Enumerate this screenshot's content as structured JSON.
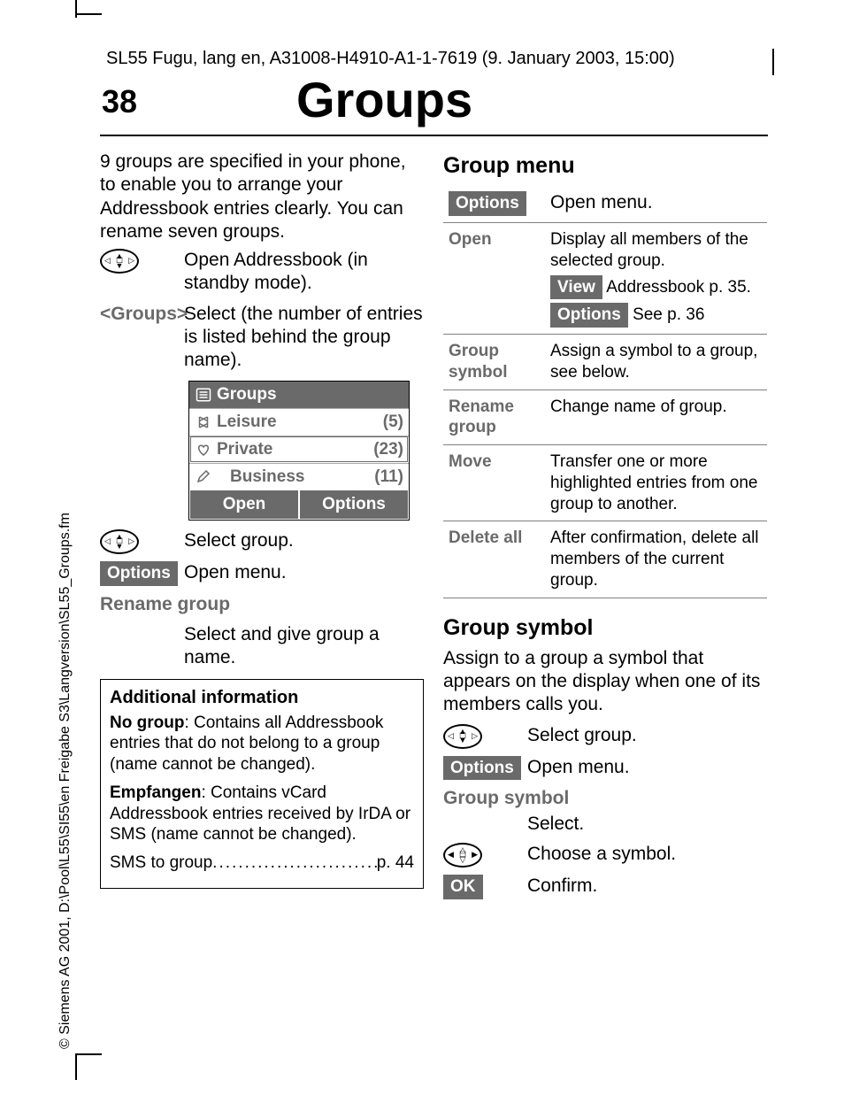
{
  "header_line": "SL55 Fugu, lang en, A31008-H4910-A1-1-7619 (9. January 2003, 15:00)",
  "side_copyright": "© Siemens AG 2001, D:\\Pool\\L55\\SI55\\en Freigabe S3\\Langversion\\SL55_Groups.fm",
  "page_number": "38",
  "title": "Groups",
  "left": {
    "intro": "9 groups are specified in your phone, to enable you to arrange your Addressbook entries clearly. You can rename seven groups.",
    "open_addr": "Open Addressbook (in standby mode).",
    "groups_tag": "<Groups>",
    "select_num": "Select (the number of entries is listed behind the group name).",
    "screen_title": "Groups",
    "screen_rows": [
      {
        "name": "Leisure",
        "count": "(5)"
      },
      {
        "name": "Private",
        "count": "(23)"
      },
      {
        "name": "Business",
        "count": "(11)"
      }
    ],
    "screen_softkeys": [
      "Open",
      "Options"
    ],
    "select_group": "Select group.",
    "options": "Options",
    "open_menu": "Open menu.",
    "rename_group": "Rename group",
    "rename_group_body": "Select and give group a name.",
    "info_title": "Additional information",
    "info_nogroup_lead": "No group",
    "info_nogroup_body": ": Contains all Addressbook entries that do not belong to a group (name cannot be changed).",
    "info_empf_lead": "Empfangen",
    "info_empf_body": ": Contains vCard Addressbook entries received by IrDA or SMS (name cannot be changed).",
    "info_sms_label": "SMS to group",
    "info_sms_page": "p. 44"
  },
  "right": {
    "group_menu_title": "Group menu",
    "options": "Options",
    "open_menu": "Open menu.",
    "rows": {
      "open_label": "Open",
      "open_body1": "Display all members of the selected group.",
      "open_view": "View",
      "open_view_body": "Addressbook p. 35.",
      "open_options": "Options",
      "open_options_body": "See p. 36",
      "groupsym_label": "Group symbol",
      "groupsym_body": "Assign a symbol to a group, see below.",
      "rename_label": "Rename group",
      "rename_body": "Change name of group.",
      "move_label": "Move",
      "move_body": "Transfer one or more highlighted entries from one group to another.",
      "delete_label": "Delete all",
      "delete_body": "After confirmation, delete all members of the current group."
    },
    "group_symbol_title": "Group symbol",
    "group_symbol_intro": "Assign to a group a symbol that appears on the display when one of its members calls you.",
    "select_group": "Select group.",
    "open_menu2": "Open menu.",
    "gs_label": "Group symbol",
    "gs_select": "Select.",
    "choose_symbol": "Choose a symbol.",
    "ok": "OK",
    "confirm": "Confirm."
  }
}
